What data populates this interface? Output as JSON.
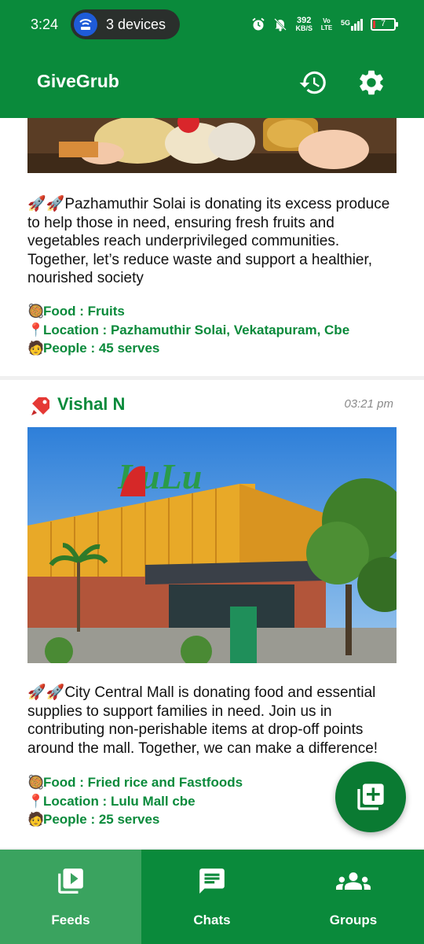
{
  "status_bar": {
    "time": "3:24",
    "devices_label": "3 devices",
    "net_speed": "392",
    "net_unit": "KB/S",
    "volte": "Vo LTE",
    "network": "5G",
    "battery": "7"
  },
  "app_bar": {
    "title": "GiveGrub",
    "icons": [
      "history-icon",
      "settings-icon"
    ]
  },
  "posts": [
    {
      "image_desc": "hands-with-food-groceries",
      "description": "🚀🚀Pazhamuthir Solai is donating its excess produce to help those in need, ensuring fresh fruits and vegetables reach underprivileged communities. Together, let’s reduce waste and support a healthier, nourished society",
      "food": "Food : Fruits",
      "location": "Location : Pazhamuthir Solai, Vekatapuram, Cbe",
      "people": "People : 45 serves"
    },
    {
      "author": "Vishal N",
      "time": "03:21 pm",
      "image_text": "LuLu",
      "description": "🚀🚀City Central Mall is donating food and essential supplies to support families in need. Join us in contributing non-perishable items at drop-off points around the mall. Together, we can make a difference!",
      "food": "Food : Fried rice and Fastfoods",
      "location": "Location : Lulu Mall cbe",
      "people": "People : 25 serves"
    }
  ],
  "meta_icons": {
    "food": "🥘",
    "location": "📍",
    "people": "🧑"
  },
  "fab": {
    "icon": "add-post-icon"
  },
  "bottom_nav": [
    {
      "label": "Feeds",
      "active": true
    },
    {
      "label": "Chats",
      "active": false
    },
    {
      "label": "Groups",
      "active": false
    }
  ],
  "colors": {
    "primary": "#0a8a3b",
    "active_tab": "#3aa35f",
    "fab": "#0a7a32"
  }
}
